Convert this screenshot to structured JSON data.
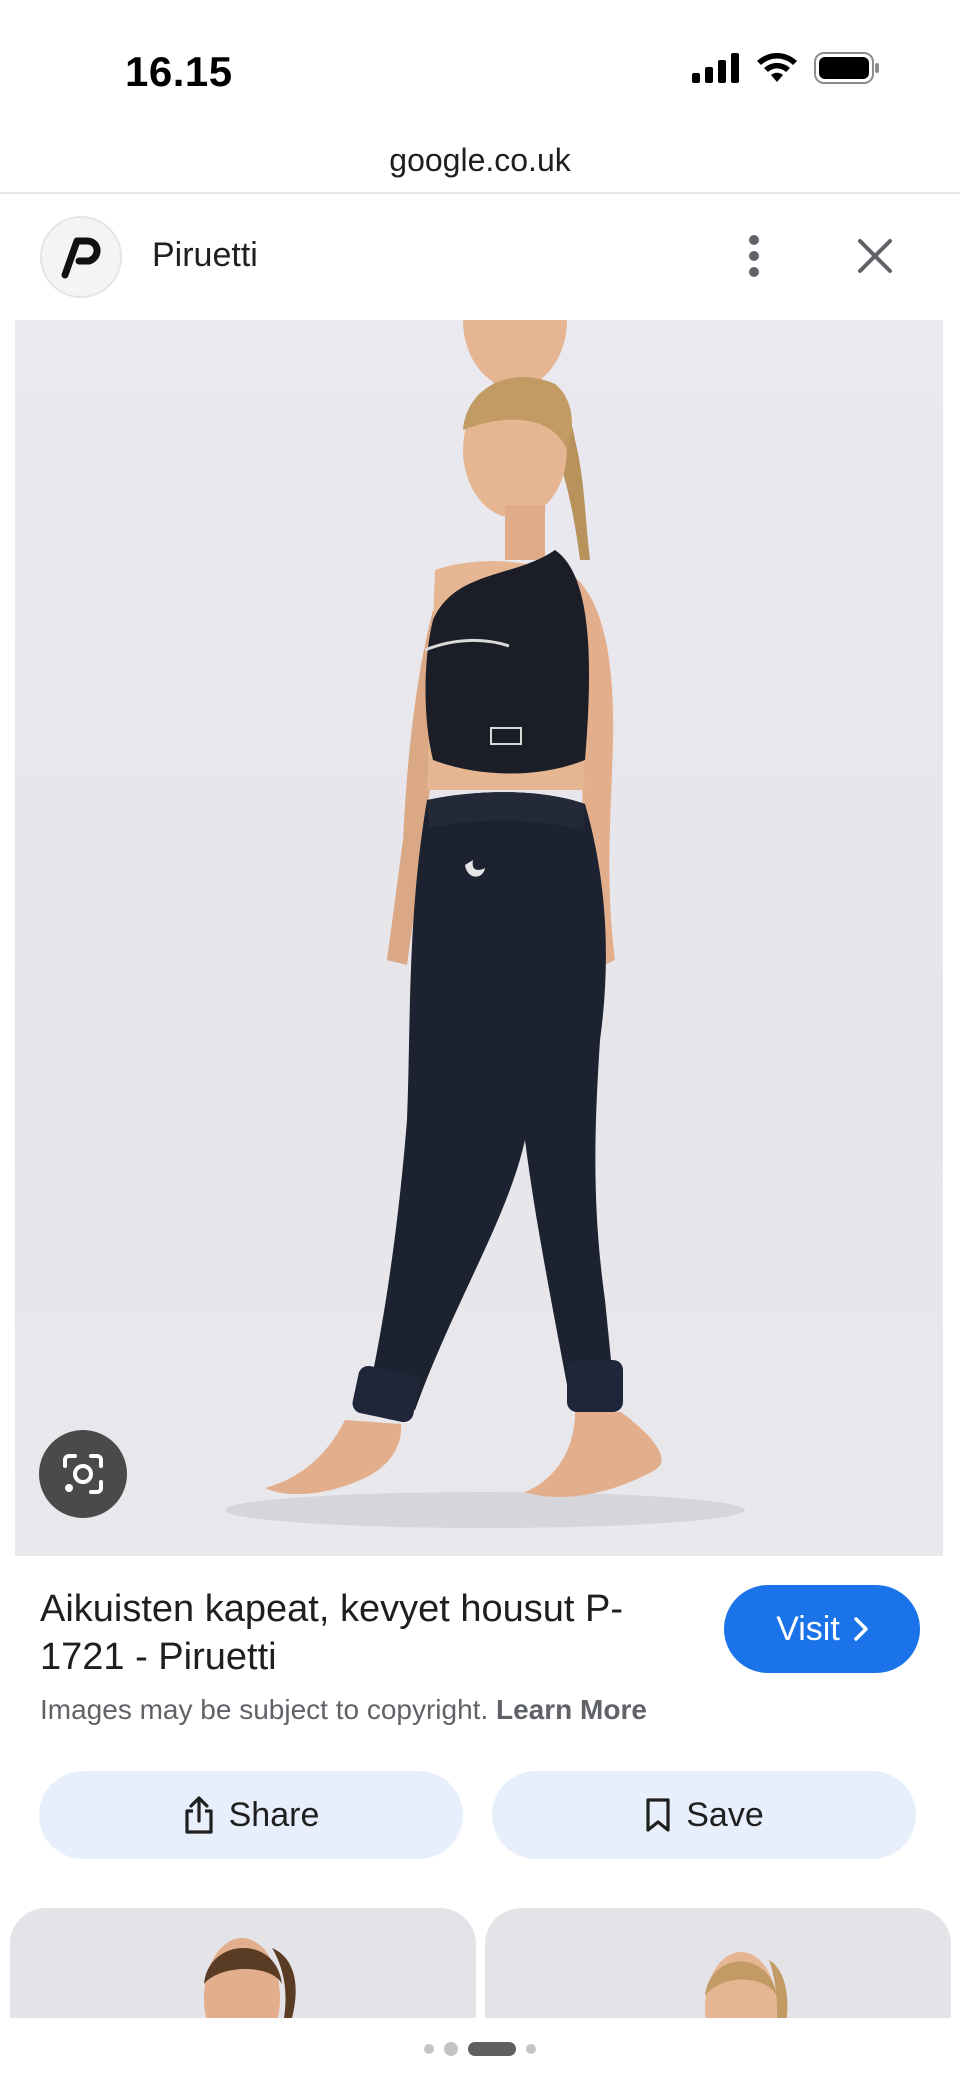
{
  "status_bar": {
    "time": "16.15"
  },
  "browser": {
    "url": "google.co.uk"
  },
  "site": {
    "name": "Piruetti"
  },
  "result": {
    "title": "Aikuisten kapeat, kevyet housut P-1721 - Piruetti",
    "visit_label": "Visit",
    "copyright_text": "Images may be subject to copyright.",
    "learn_more_label": "Learn More"
  },
  "actions": {
    "share_label": "Share",
    "save_label": "Save"
  },
  "pager": {
    "count": 4,
    "active_index": 2
  },
  "colors": {
    "accent": "#1a73e8",
    "action_bg": "#e8effc",
    "clothing": "#1c2230",
    "skin": "#e9b894",
    "hair": "#c29a63"
  },
  "icons": [
    "signal-icon",
    "wifi-icon",
    "battery-icon",
    "piruetti-logo",
    "more-vert-icon",
    "close-icon",
    "lens-icon",
    "chevron-right-icon",
    "share-icon",
    "bookmark-icon"
  ]
}
